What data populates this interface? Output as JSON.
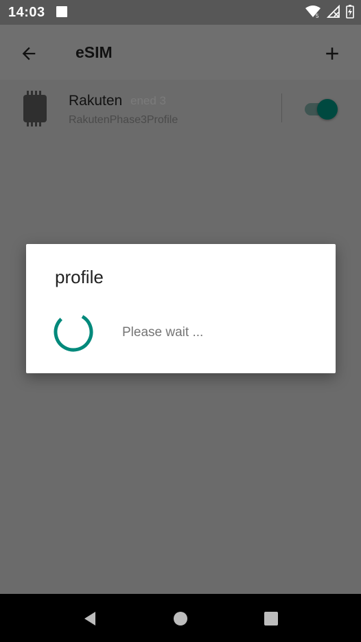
{
  "status_bar": {
    "time": "14:03",
    "icons": [
      "notification-square-icon",
      "wifi-icon",
      "no-signal-icon",
      "battery-charging-icon"
    ]
  },
  "app_bar": {
    "title": "eSIM",
    "back_icon": "arrow-back-icon",
    "add_icon": "add-icon"
  },
  "profile": {
    "name": "Rakuten",
    "ghost_text": "ened 3",
    "subtitle": "RakutenPhase3Profile",
    "enabled": true,
    "icon": "sim-chip-icon"
  },
  "dialog": {
    "title": "profile",
    "message": "Please wait ..."
  },
  "nav_bar": {
    "icons": [
      "back-triangle-icon",
      "home-circle-icon",
      "recents-square-icon"
    ]
  },
  "colors": {
    "accent": "#00897b",
    "toggle_thumb": "#004940",
    "scrim": "#6b6b6b"
  }
}
